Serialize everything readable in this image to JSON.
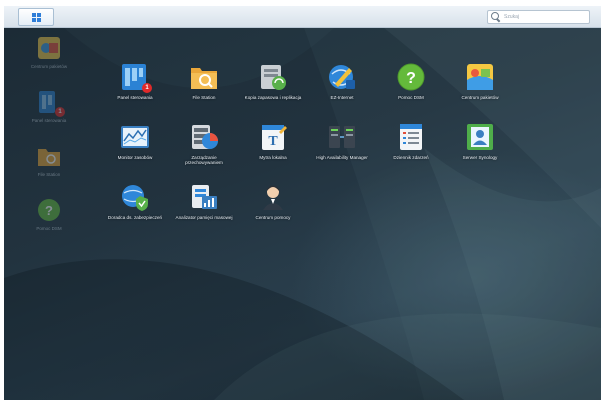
{
  "taskbar": {
    "start_icon": "grid-icon",
    "search_placeholder": "Szukaj"
  },
  "sidebar": {
    "items": [
      {
        "label": "Centrum pakietów",
        "icon": "package-center-icon",
        "badge": ""
      },
      {
        "label": "Panel sterowania",
        "icon": "control-panel-icon",
        "badge": "1"
      },
      {
        "label": "File Station",
        "icon": "file-station-icon",
        "badge": ""
      },
      {
        "label": "Pomoc DSM",
        "icon": "help-icon",
        "badge": ""
      }
    ]
  },
  "apps": [
    {
      "label": "Panel sterowania",
      "icon": "control-panel-icon",
      "badge": "1"
    },
    {
      "label": "File Station",
      "icon": "file-station-icon",
      "badge": ""
    },
    {
      "label": "Kopia zapasowa i replikacja",
      "icon": "backup-replication-icon",
      "badge": ""
    },
    {
      "label": "EZ-Internet",
      "icon": "ez-internet-icon",
      "badge": ""
    },
    {
      "label": "Pomoc DSM",
      "icon": "help-icon",
      "badge": ""
    },
    {
      "label": "Centrum pakietów",
      "icon": "package-center-icon",
      "badge": ""
    },
    {
      "label": "Monitor zasobów",
      "icon": "resource-monitor-icon",
      "badge": ""
    },
    {
      "label": "Zarządzanie przechowywaniem",
      "icon": "storage-manager-icon",
      "badge": ""
    },
    {
      "label": "Mytra lokalna",
      "icon": "notepad-icon",
      "badge": ""
    },
    {
      "label": "High Availability Manager",
      "icon": "high-availability-icon",
      "badge": ""
    },
    {
      "label": "Dziennik zdarzeń",
      "icon": "log-center-icon",
      "badge": ""
    },
    {
      "label": "Serwer Synology",
      "icon": "directory-server-icon",
      "badge": ""
    },
    {
      "label": "Doradca ds. zabezpieczeń",
      "icon": "security-advisor-icon",
      "badge": ""
    },
    {
      "label": "Analizator pamięci masowej",
      "icon": "storage-analyzer-icon",
      "badge": ""
    },
    {
      "label": "Centrum pomocy",
      "icon": "support-center-icon",
      "badge": ""
    }
  ]
}
